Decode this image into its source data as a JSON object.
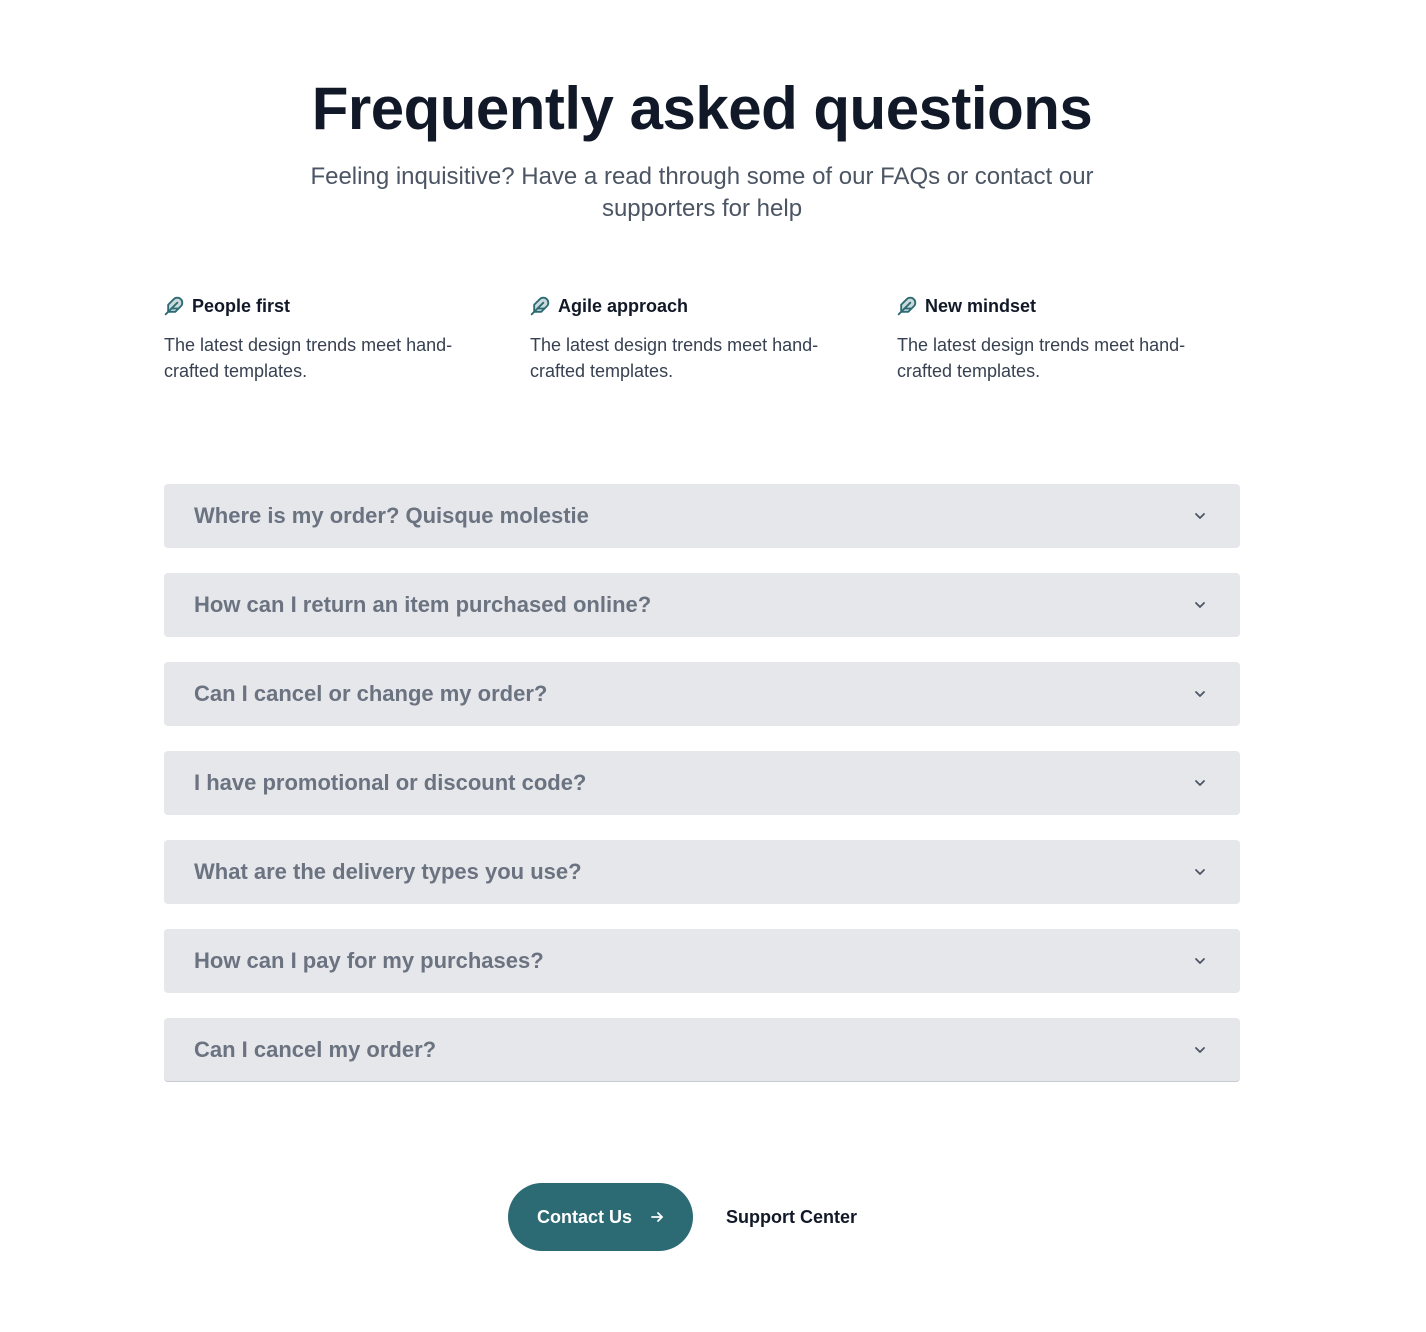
{
  "header": {
    "title": "Frequently asked questions",
    "subtitle": "Feeling inquisitive? Have a read through some of our FAQs or contact our supporters for help"
  },
  "features": [
    {
      "icon": "feather-icon",
      "title": "People first",
      "description": "The latest design trends meet hand-crafted templates."
    },
    {
      "icon": "feather-icon",
      "title": "Agile approach",
      "description": "The latest design trends meet hand-crafted templates."
    },
    {
      "icon": "feather-icon",
      "title": "New mindset",
      "description": "The latest design trends meet hand-crafted templates."
    }
  ],
  "faq": {
    "items": [
      {
        "question": "Where is my order? Quisque molestie"
      },
      {
        "question": "How can I return an item purchased online?"
      },
      {
        "question": "Can I cancel or change my order?"
      },
      {
        "question": "I have promotional or discount code?"
      },
      {
        "question": "What are the delivery types you use?"
      },
      {
        "question": "How can I pay for my purchases?"
      },
      {
        "question": "Can I cancel my order?"
      }
    ]
  },
  "actions": {
    "contact_label": "Contact Us",
    "support_label": "Support Center"
  },
  "colors": {
    "accent": "#2d6b74",
    "faq_background": "#e5e7eb",
    "heading": "#111827",
    "muted": "#6b7280"
  }
}
